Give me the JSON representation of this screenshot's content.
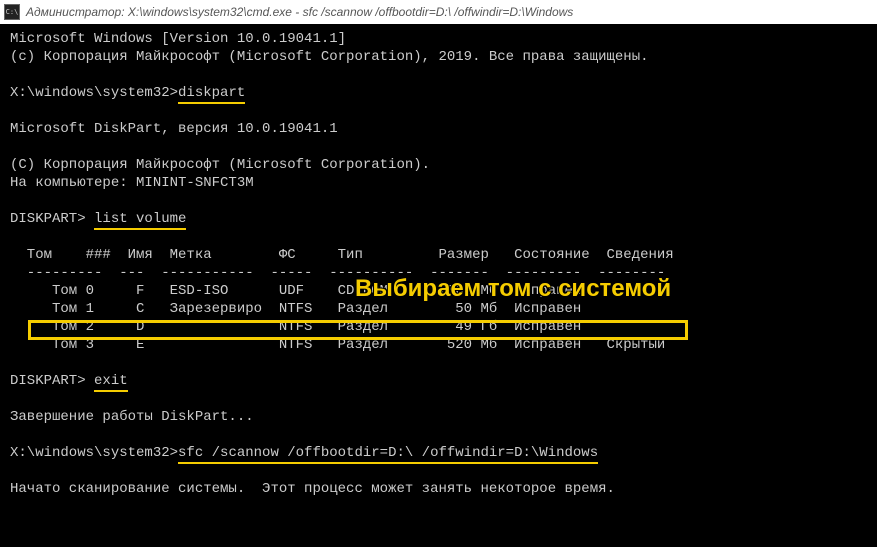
{
  "titlebar": {
    "icon_label": "C:\\",
    "text": "Администратор: X:\\windows\\system32\\cmd.exe - sfc  /scannow /offbootdir=D:\\ /offwindir=D:\\Windows"
  },
  "lines": {
    "l1": "Microsoft Windows [Version 10.0.19041.1]",
    "l2": "(c) Корпорация Майкрософт (Microsoft Corporation), 2019. Все права защищены.",
    "l3_prompt": "X:\\windows\\system32>",
    "l3_cmd": "diskpart",
    "l4": "Microsoft DiskPart, версия 10.0.19041.1",
    "l5": "(C) Корпорация Майкрософт (Microsoft Corporation).",
    "l6": "На компьютере: MININT-SNFCT3M",
    "l7_prompt": "DISKPART> ",
    "l7_cmd": "list volume",
    "header": "  Том    ###  Имя  Метка        ФС     Тип         Размер   Состояние  Сведения",
    "divider": "  ---------  ---  -----------  -----  ----------  -------  ---------  --------",
    "r0": "     Том 0     F   ESD-ISO      UDF    CD-ROM      7365 Мб  Исправен",
    "r1": "     Том 1     C   Зарезервиро  NTFS   Раздел        50 Мб  Исправен",
    "r2": "     Том 2     D                NTFS   Раздел        49 Гб  Исправен",
    "r3": "     Том 3     E                NTFS   Раздел       520 Мб  Исправен   Скрытый",
    "l8_prompt": "DISKPART> ",
    "l8_cmd": "exit",
    "l9": "Завершение работы DiskPart...",
    "l10_prompt": "X:\\windows\\system32>",
    "l10_cmd": "sfc /scannow /offbootdir=D:\\ /offwindir=D:\\Windows",
    "l11": "Начато сканирование системы.  Этот процесс может занять некоторое время."
  },
  "annotation": {
    "text": "Выбираем том с системой"
  }
}
